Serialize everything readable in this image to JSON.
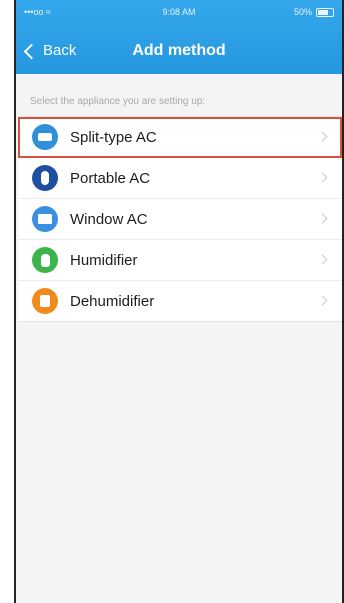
{
  "status_bar": {
    "carrier": "•••oo ≈",
    "time": "9:08 AM",
    "battery": "50%"
  },
  "nav": {
    "back_label": "Back",
    "title": "Add method"
  },
  "hint": "Select the appliance you are setting up:",
  "appliances": [
    {
      "label": "Split-type AC",
      "icon": "split-ac-icon",
      "color": "#2f8fd8",
      "selected": true
    },
    {
      "label": "Portable AC",
      "icon": "portable-ac-icon",
      "color": "#1e4fa0",
      "selected": false
    },
    {
      "label": "Window AC",
      "icon": "window-ac-icon",
      "color": "#3b8fe0",
      "selected": false
    },
    {
      "label": "Humidifier",
      "icon": "humidifier-icon",
      "color": "#3bb54a",
      "selected": false
    },
    {
      "label": "Dehumidifier",
      "icon": "dehumidifier-icon",
      "color": "#f08a1c",
      "selected": false
    }
  ],
  "colors": {
    "header": "#2b9ee6",
    "selection_outline": "#d9533a"
  }
}
